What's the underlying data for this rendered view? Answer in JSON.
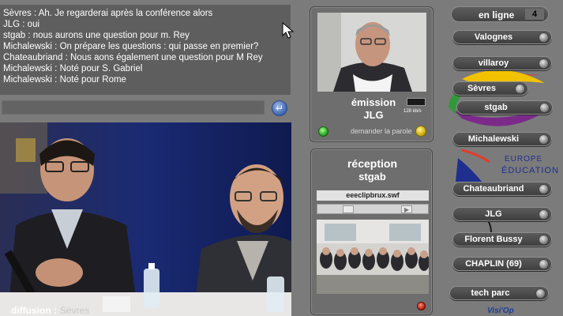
{
  "chat": {
    "lines": [
      "Sèvres : Ah. Je regarderai après la conférence alors",
      "JLG : oui",
      "stgab : nous aurons une question pour m. Rey",
      "Michalewski : On prépare les questions : qui passe en premier?",
      "Chateaubriand : Nous aons également une question pour M Rey",
      "Michalewski : Noté pour S. Gabriel",
      "Michalewski : Noté pour Rome"
    ],
    "input_value": "",
    "send_icon": "enter-arrow-icon"
  },
  "diffusion": {
    "label": "diffusion :",
    "value": "Sèvres"
  },
  "emission": {
    "title": "émission",
    "name": "JLG",
    "bitrate": "128 kb/s",
    "ask_label": "demander la parole",
    "led_color": "#27b31f",
    "button_color": "#e3c400"
  },
  "reception": {
    "title": "réception",
    "name": "stgab",
    "filename": "eeeclipbrux.swf",
    "led_color": "#d02a10"
  },
  "online": {
    "label": "en ligne",
    "count": "4"
  },
  "participants": [
    "Valognes",
    "villaroy",
    "Sèvres",
    "stgab",
    "Michalewski",
    "Chateaubriand",
    "JLG",
    "Florent Bussy",
    "CHAPLIN (69)",
    "tech parc"
  ],
  "logo": {
    "line1": "EUROPE",
    "line2": "ÉDUCATION",
    "accent_colors": [
      "#e23b2a",
      "#f2c200",
      "#3c2a8c",
      "#2f9a3a"
    ]
  },
  "brand": "Visi'Op"
}
